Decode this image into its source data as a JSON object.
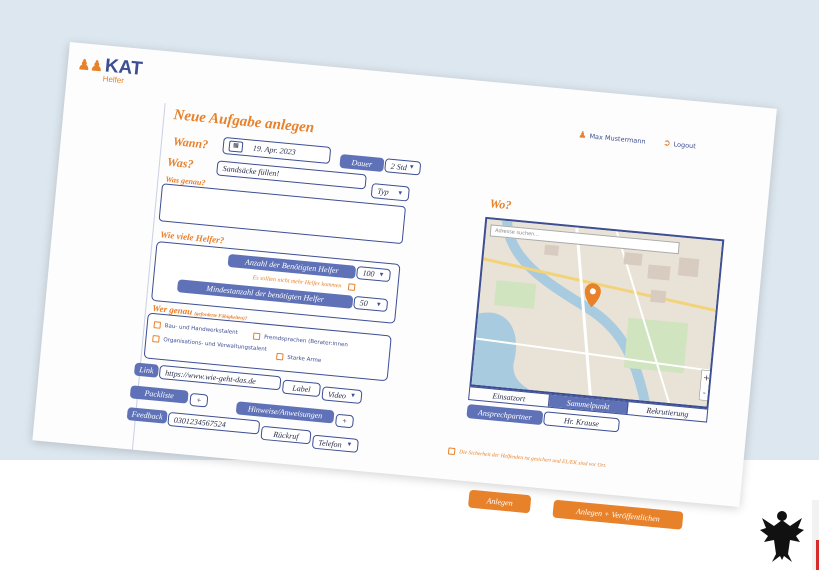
{
  "app": {
    "logo_text": "KAT",
    "logo_sub": "Helfer"
  },
  "header": {
    "user_name": "Max Mustermann",
    "logout_label": "Logout"
  },
  "form": {
    "page_title": "Neue Aufgabe anlegen",
    "when": {
      "label": "Wann?",
      "date": "19. Apr. 2023",
      "duration_label": "Dauer",
      "duration_value": "2 Std"
    },
    "what": {
      "label": "Was?",
      "task_value": "Sandsäcke füllen!",
      "type_label": "Typ"
    },
    "details": {
      "label": "Was genau?",
      "value": ""
    },
    "helpers": {
      "section_label": "Wie viele Helfer?",
      "count_label": "Anzahl der Benötigten Helfer",
      "count_value": "100",
      "max_hint": "Es sollten nicht mehr Helfer kommen",
      "min_label": "Mindestanzahl der benötigten Helfer",
      "min_value": "50"
    },
    "skills": {
      "section_label": "Wer genau",
      "section_hint": "(geforderte Fähigkeiten)?",
      "options": [
        "Bau- und Handwerkstalent",
        "Fremdsprachen (Berater:innen",
        "Organisations- und Verwaltungstalent",
        "Starke Arme"
      ]
    },
    "link": {
      "label": "Link",
      "value": "https://www.wie-geht-das.de",
      "label_button": "Label",
      "type_value": "Video"
    },
    "packlist": {
      "label": "Packliste",
      "add": "+"
    },
    "instructions": {
      "label": "Hinweise/Anweisungen",
      "add": "+"
    },
    "feedback": {
      "label": "Feedback",
      "value": "0301234567524",
      "callback": "Rückruf",
      "channel": "Telefon"
    }
  },
  "where": {
    "label": "Wo?",
    "search_placeholder": "Adresse suchen...",
    "tabs": [
      "Einsatzort",
      "Sammelpunkt",
      "Rekrutierung"
    ],
    "active_tab": "Sammelpunkt",
    "contact_label": "Ansprechpartner",
    "contact_value": "Hr. Krause"
  },
  "footer": {
    "safety_text": "Die Sicherheit der Helfenden ist gesichert und EL/EK sind vor Ort.",
    "create_button": "Anlegen",
    "publish_button": "Anlegen + Veröffentlichen"
  },
  "colors": {
    "primary": "#3d4e93",
    "accent": "#e7812a",
    "background": "#dde7ef"
  }
}
